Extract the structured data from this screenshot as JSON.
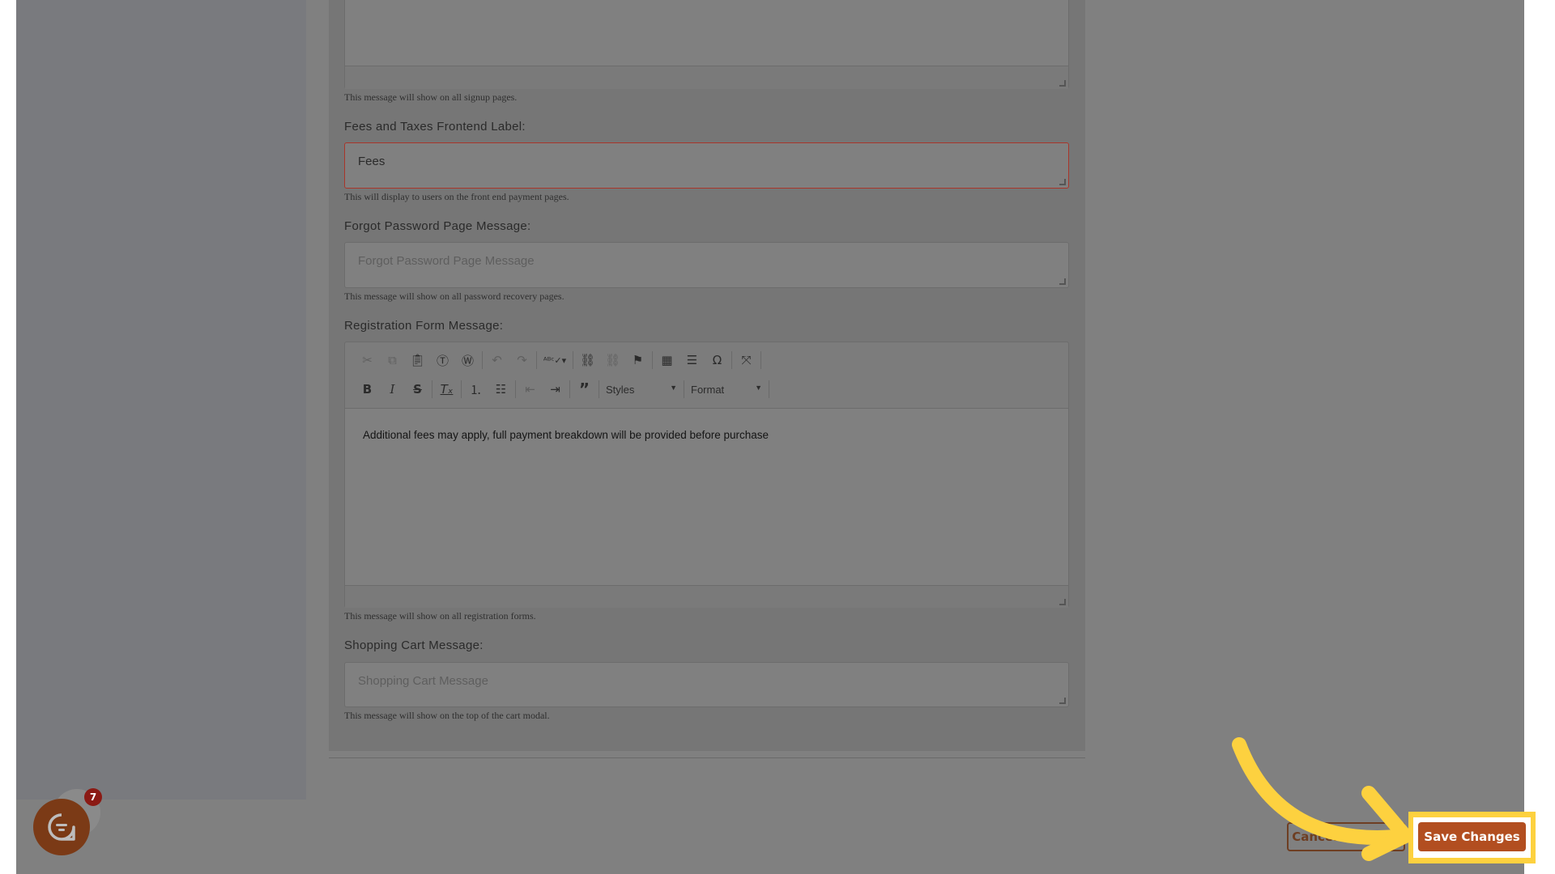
{
  "form": {
    "signup_help": "This message will show on all signup pages.",
    "fees_label": "Fees and Taxes Frontend Label:",
    "fees_value": "Fees",
    "fees_help": "This will display to users on the front end payment pages.",
    "forgot_label": "Forgot Password Page Message:",
    "forgot_placeholder": "Forgot Password Page Message",
    "forgot_help": "This message will show on all password recovery pages.",
    "registration_label": "Registration Form Message:",
    "registration_content": "Additional fees may apply, full payment breakdown will be provided before purchase",
    "registration_help": "This message will show on all registration forms.",
    "cart_label": "Shopping Cart Message:",
    "cart_placeholder": "Shopping Cart Message",
    "cart_help": "This message will show on the top of the cart modal."
  },
  "editor_toolbar": {
    "styles_label": "Styles",
    "format_label": "Format"
  },
  "actions": {
    "cancel_label": "Cancel Changes",
    "save_label": "Save Changes"
  },
  "chat_widget": {
    "badge_count": "7"
  },
  "colors": {
    "accent": "#b24e20",
    "highlight": "#fdd13f",
    "error_border": "#c0392b"
  }
}
